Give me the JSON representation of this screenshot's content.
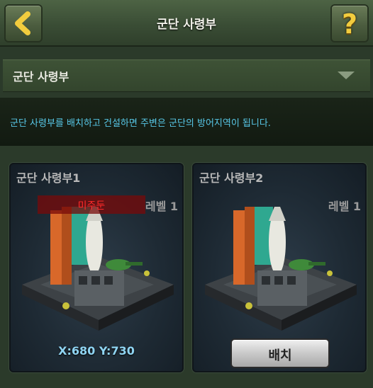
{
  "header": {
    "title": "군단 사령부",
    "back_icon": "chevron-left-icon",
    "help_icon": "question-mark-icon",
    "help_glyph": "?"
  },
  "dropdown": {
    "selected": "군단 사령부",
    "arrow_icon": "triangle-down-icon"
  },
  "description": "군단 사령부를 배치하고 건설하면 주변은 군단의 방어지역이 됩니다.",
  "cards": [
    {
      "name": "군단 사령부1",
      "level": "레벨 1",
      "status": "미주둔",
      "coordinates": "X:680 Y:730"
    },
    {
      "name": "군단 사령부2",
      "level": "레벨 1",
      "button": "배치"
    }
  ],
  "colors": {
    "accent_text": "#58c8e8",
    "status_red": "#ff2a2a",
    "help_yellow": "#f2cc3e"
  }
}
